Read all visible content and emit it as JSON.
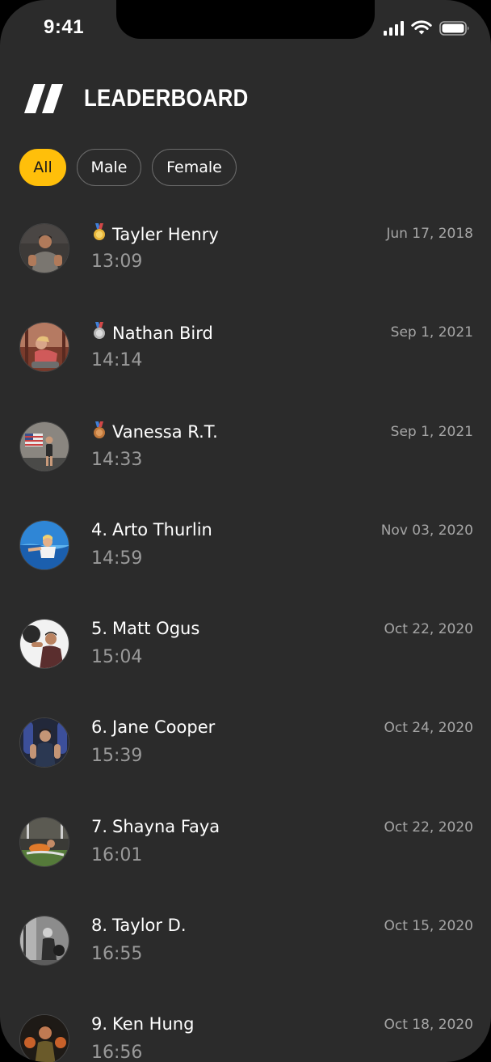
{
  "status_bar": {
    "time": "9:41",
    "icons": [
      "cellular-signal-icon",
      "wifi-icon",
      "battery-icon"
    ]
  },
  "header": {
    "logo_icon": "double-slash-logo-icon",
    "title": "LEADERBOARD"
  },
  "filters": {
    "all_label": "All",
    "male_label": "Male",
    "female_label": "Female",
    "selected": "All",
    "accent_color": "#ffbf0a"
  },
  "entries": [
    {
      "rank": "",
      "medal": "gold-medal-icon",
      "name": "Tayler Henry",
      "time": "13:09",
      "date": "Jun 17, 2018"
    },
    {
      "rank": "",
      "medal": "silver-medal-icon",
      "name": "Nathan Bird",
      "time": "14:14",
      "date": "Sep 1, 2021"
    },
    {
      "rank": "",
      "medal": "bronze-medal-icon",
      "name": "Vanessa R.T.",
      "time": "14:33",
      "date": "Sep 1, 2021"
    },
    {
      "rank": "4.",
      "medal": "",
      "name": "Arto Thurlin",
      "time": "14:59",
      "date": "Nov 03, 2020"
    },
    {
      "rank": "5.",
      "medal": "",
      "name": "Matt Ogus",
      "time": "15:04",
      "date": "Oct 22, 2020"
    },
    {
      "rank": "6.",
      "medal": "",
      "name": "Jane Cooper",
      "time": "15:39",
      "date": "Oct 24, 2020"
    },
    {
      "rank": "7.",
      "medal": "",
      "name": "Shayna Faya",
      "time": "16:01",
      "date": "Oct 22, 2020"
    },
    {
      "rank": "8.",
      "medal": "",
      "name": "Taylor D.",
      "time": "16:55",
      "date": "Oct 15, 2020"
    },
    {
      "rank": "9.",
      "medal": "",
      "name": "Ken Hung",
      "time": "16:56",
      "date": "Oct 18, 2020"
    }
  ],
  "colors": {
    "background": "#2b2b2b",
    "text_primary": "#ffffff",
    "text_secondary": "#9a9a9a",
    "gold": "#e8b53a",
    "silver": "#b8b8b8",
    "bronze": "#c0773a"
  }
}
